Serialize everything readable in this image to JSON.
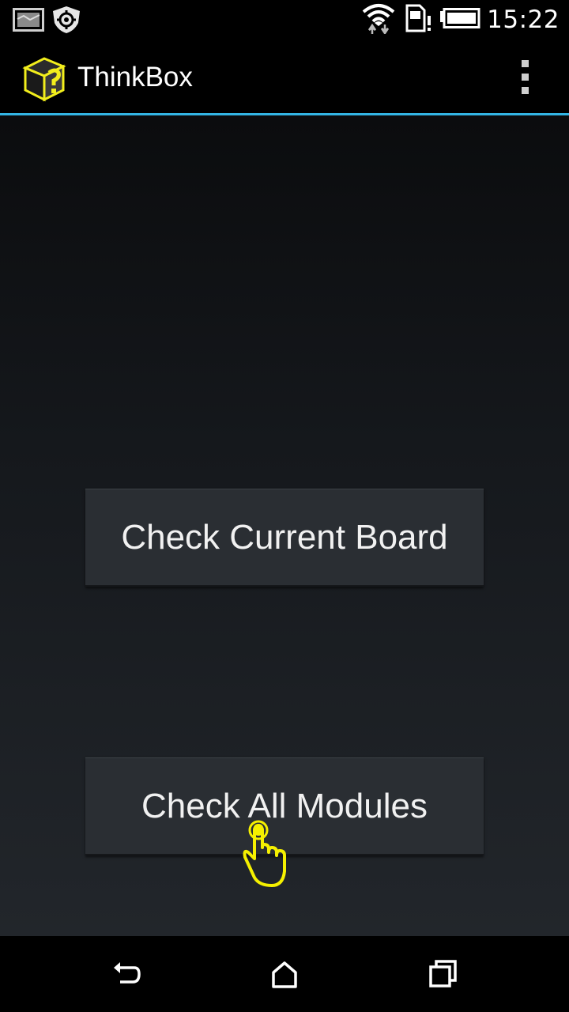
{
  "status_bar": {
    "time": "15:22",
    "icons": [
      "screenshot-icon",
      "settings-shield-icon",
      "wifi-icon",
      "sim-card-icon",
      "battery-icon"
    ]
  },
  "action_bar": {
    "title": "ThinkBox",
    "logo_icon": "thinkbox-logo-icon",
    "overflow_icon": "overflow-menu-icon",
    "accent_color": "#33b5e5"
  },
  "main": {
    "buttons": [
      {
        "label": "Check Current Board"
      },
      {
        "label": "Check All Modules"
      }
    ]
  },
  "nav_bar": {
    "icons": [
      "back-icon",
      "home-icon",
      "recents-icon"
    ]
  },
  "colors": {
    "logo_yellow": "#f2ee1c",
    "touch_yellow": "#f5f000"
  }
}
